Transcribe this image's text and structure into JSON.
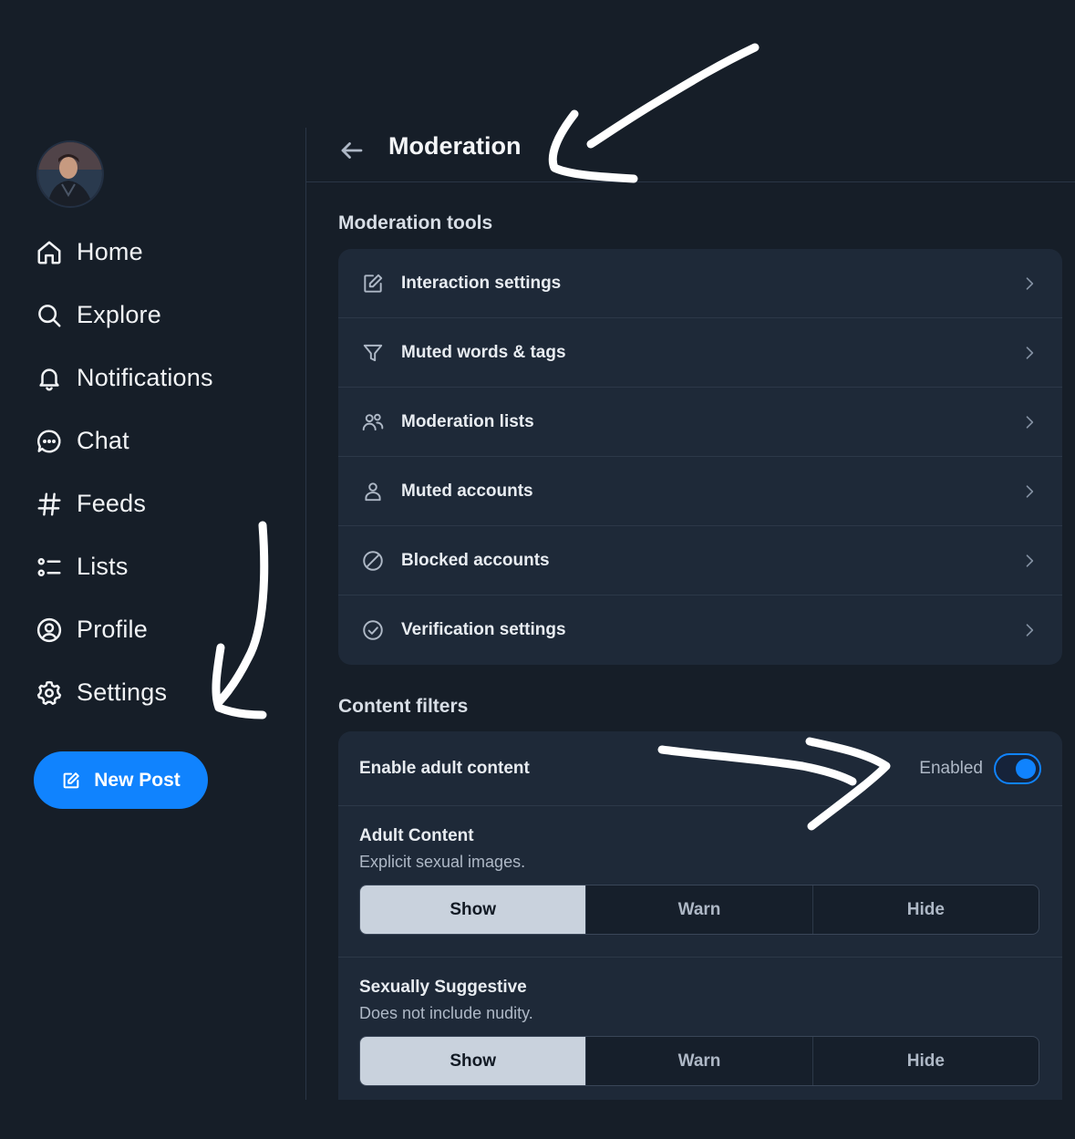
{
  "sidebar": {
    "nav": [
      {
        "label": "Home",
        "icon": "home-icon"
      },
      {
        "label": "Explore",
        "icon": "search-icon"
      },
      {
        "label": "Notifications",
        "icon": "bell-icon"
      },
      {
        "label": "Chat",
        "icon": "chat-bubble-icon"
      },
      {
        "label": "Feeds",
        "icon": "hashtag-icon"
      },
      {
        "label": "Lists",
        "icon": "list-icon"
      },
      {
        "label": "Profile",
        "icon": "user-circle-icon"
      },
      {
        "label": "Settings",
        "icon": "gear-icon"
      }
    ],
    "new_post_label": "New Post"
  },
  "header": {
    "title": "Moderation"
  },
  "moderation_tools": {
    "title": "Moderation tools",
    "items": [
      {
        "label": "Interaction settings",
        "icon": "edit-square-icon"
      },
      {
        "label": "Muted words & tags",
        "icon": "filter-funnel-icon"
      },
      {
        "label": "Moderation lists",
        "icon": "people-icon"
      },
      {
        "label": "Muted accounts",
        "icon": "person-icon"
      },
      {
        "label": "Blocked accounts",
        "icon": "blocked-circle-icon"
      },
      {
        "label": "Verification settings",
        "icon": "check-circle-icon"
      }
    ]
  },
  "content_filters": {
    "title": "Content filters",
    "adult_toggle": {
      "label": "Enable adult content",
      "state_label": "Enabled",
      "enabled": true
    },
    "filters": [
      {
        "title": "Adult Content",
        "description": "Explicit sexual images.",
        "options": [
          "Show",
          "Warn",
          "Hide"
        ],
        "selected": "Show"
      },
      {
        "title": "Sexually Suggestive",
        "description": "Does not include nudity.",
        "options": [
          "Show",
          "Warn",
          "Hide"
        ],
        "selected": "Show"
      }
    ]
  },
  "colors": {
    "background": "#161e28",
    "card": "#1e2938",
    "accent": "#1083fe",
    "selected_segment": "#c9d2dd"
  }
}
